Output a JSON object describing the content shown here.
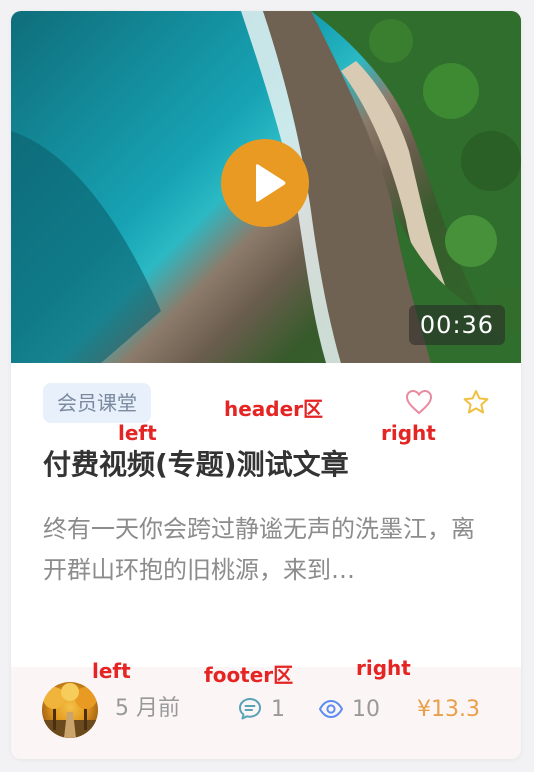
{
  "video": {
    "duration": "00:36",
    "play_icon": "play-icon"
  },
  "header": {
    "tag": "会员课堂",
    "icons": [
      "heart-icon",
      "star-icon"
    ]
  },
  "article": {
    "title": "付费视频(专题)测试文章",
    "excerpt": "终有一天你会跨过静谧无声的洗墨江，离开群山环抱的旧桃源，来到…"
  },
  "footer": {
    "time": "5 月前",
    "comments": "1",
    "views": "10",
    "price": "¥13.3"
  },
  "annotations": {
    "header_label": "header区",
    "header_left": "left",
    "header_right": "right",
    "footer_label": "footer区",
    "footer_left": "left",
    "footer_right": "right"
  },
  "colors": {
    "play": "#e89a22",
    "price": "#e8a04a",
    "star": "#f0c040",
    "heart": "#e98aa0",
    "views_icon": "#5b8ef0",
    "comments_icon": "#5aa3b7",
    "annotation": "#e52424",
    "footer_bg": "#fcf5f6",
    "tag_bg": "#e8f0fb"
  }
}
